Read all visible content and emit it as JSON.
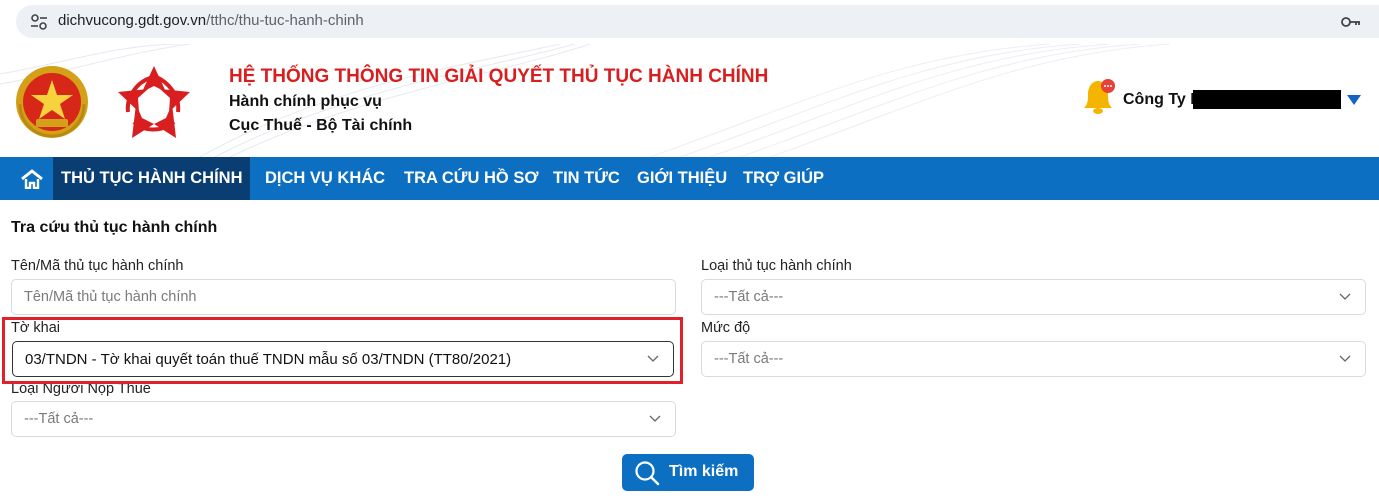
{
  "browser": {
    "url_host": "dichvucong.gdt.gov.vn",
    "url_path": "/tthc/thu-tuc-hanh-chinh"
  },
  "header": {
    "system_title": "HỆ THỐNG THÔNG TIN GIẢI QUYẾT THỦ TỤC HÀNH CHÍNH",
    "subtitle_1": "Hành chính phục vụ",
    "subtitle_2": "Cục Thuế - Bộ Tài chính",
    "user_prefix": "Công Ty B"
  },
  "nav": {
    "items": [
      {
        "label": "THỦ TỤC HÀNH CHÍNH"
      },
      {
        "label": "DỊCH VỤ KHÁC"
      },
      {
        "label": "TRA CỨU HỒ SƠ"
      },
      {
        "label": "TIN TỨC"
      },
      {
        "label": "GIỚI THIỆU"
      },
      {
        "label": "TRỢ GIÚP"
      }
    ]
  },
  "form": {
    "title": "Tra cứu thủ tục hành chính",
    "name_label": "Tên/Mã thủ tục hành chính",
    "name_placeholder": "Tên/Mã thủ tục hành chính",
    "type_label": "Loại thủ tục hành chính",
    "type_value": "---Tất cả---",
    "form_label": "Tờ khai",
    "form_value": "03/TNDN - Tờ khai quyết toán thuế TNDN mẫu số 03/TNDN (TT80/2021)",
    "level_label": "Mức độ",
    "level_value": "---Tất cả---",
    "taxpayer_label": "Loại Người Nộp Thuế",
    "taxpayer_value": "---Tất cả---",
    "search_label": "Tìm kiếm"
  },
  "colors": {
    "nav_bg": "#0c6fc2",
    "nav_active": "#0a3d72",
    "title_red": "#d81e1e",
    "highlight": "#e0202a"
  }
}
